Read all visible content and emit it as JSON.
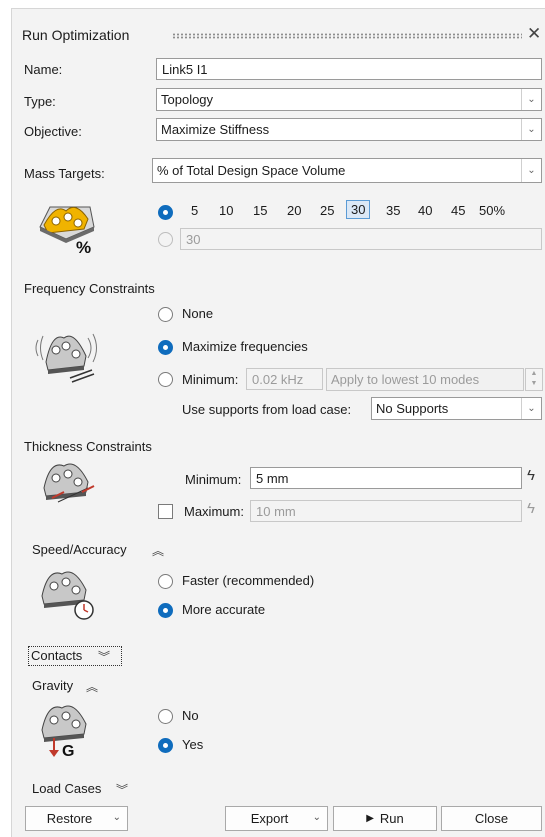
{
  "panel": {
    "title": "Run Optimization",
    "close_glyph": "✕"
  },
  "name": {
    "label": "Name:",
    "value": "Link5 I1"
  },
  "type": {
    "label": "Type:",
    "value": "Topology"
  },
  "objective": {
    "label": "Objective:",
    "value": "Maximize Stiffness"
  },
  "mass_targets": {
    "label": "Mass Targets:",
    "value": "% of Total Design Space Volume",
    "options": [
      "5",
      "10",
      "15",
      "20",
      "25",
      "30",
      "35",
      "40",
      "45",
      "50%"
    ],
    "selected": "30",
    "custom_value": "30",
    "percent_symbol": "%"
  },
  "frequency": {
    "heading": "Frequency Constraints",
    "none_label": "None",
    "maximize_label": "Maximize frequencies",
    "minimum_label": "Minimum:",
    "minimum_value": "0.02 kHz",
    "apply_value": "Apply to lowest 10 modes",
    "supports_label": "Use supports from load case:",
    "supports_value": "No Supports"
  },
  "thickness": {
    "heading": "Thickness Constraints",
    "minimum_label": "Minimum:",
    "minimum_value": "5 mm",
    "maximum_label": "Maximum:",
    "maximum_value": "10 mm"
  },
  "speed": {
    "heading": "Speed/Accuracy",
    "faster_label": "Faster (recommended)",
    "accurate_label": "More accurate"
  },
  "contacts": {
    "heading": "Contacts"
  },
  "gravity": {
    "heading": "Gravity",
    "no_label": "No",
    "yes_label": "Yes",
    "g_label": "G"
  },
  "load_cases": {
    "heading": "Load Cases"
  },
  "footer": {
    "restore": "Restore",
    "export": "Export",
    "run": "Run",
    "close": "Close"
  }
}
